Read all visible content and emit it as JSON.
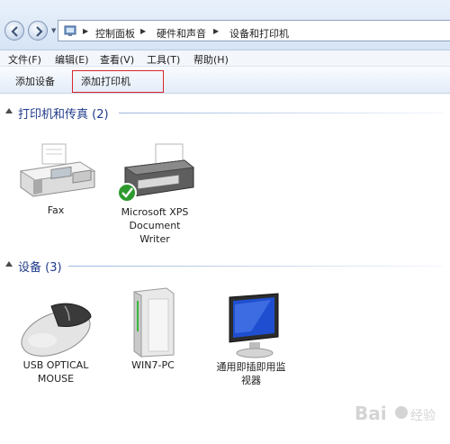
{
  "breadcrumb": [
    {
      "label": "控制面板"
    },
    {
      "label": "硬件和声音"
    },
    {
      "label": "设备和打印机"
    }
  ],
  "menu": [
    {
      "label": "文件(F)"
    },
    {
      "label": "编辑(E)"
    },
    {
      "label": "查看(V)"
    },
    {
      "label": "工具(T)"
    },
    {
      "label": "帮助(H)"
    }
  ],
  "toolbar": {
    "add_device": "添加设备",
    "add_printer": "添加打印机"
  },
  "groups": {
    "printers": {
      "title": "打印机和传真 (2)",
      "items": [
        {
          "label": "Fax",
          "icon": "fax-icon"
        },
        {
          "label": "Microsoft XPS Document Writer",
          "label_lines": [
            "Microsoft XPS",
            "Document",
            "Writer"
          ],
          "icon": "printer-icon",
          "default_check": true
        }
      ]
    },
    "devices": {
      "title": "设备 (3)",
      "items": [
        {
          "label": "USB OPTICAL MOUSE",
          "label_lines": [
            "USB OPTICAL",
            "MOUSE"
          ],
          "icon": "mouse-icon"
        },
        {
          "label": "WIN7-PC",
          "icon": "computer-tower-icon"
        },
        {
          "label": "通用即插即用监视器",
          "label_lines": [
            "通用即插即用监",
            "视器"
          ],
          "icon": "monitor-icon"
        }
      ]
    }
  },
  "colors": {
    "highlight_border": "#d9262c",
    "group_title": "#1e3a8a",
    "default_check": "#2e9a2e"
  }
}
